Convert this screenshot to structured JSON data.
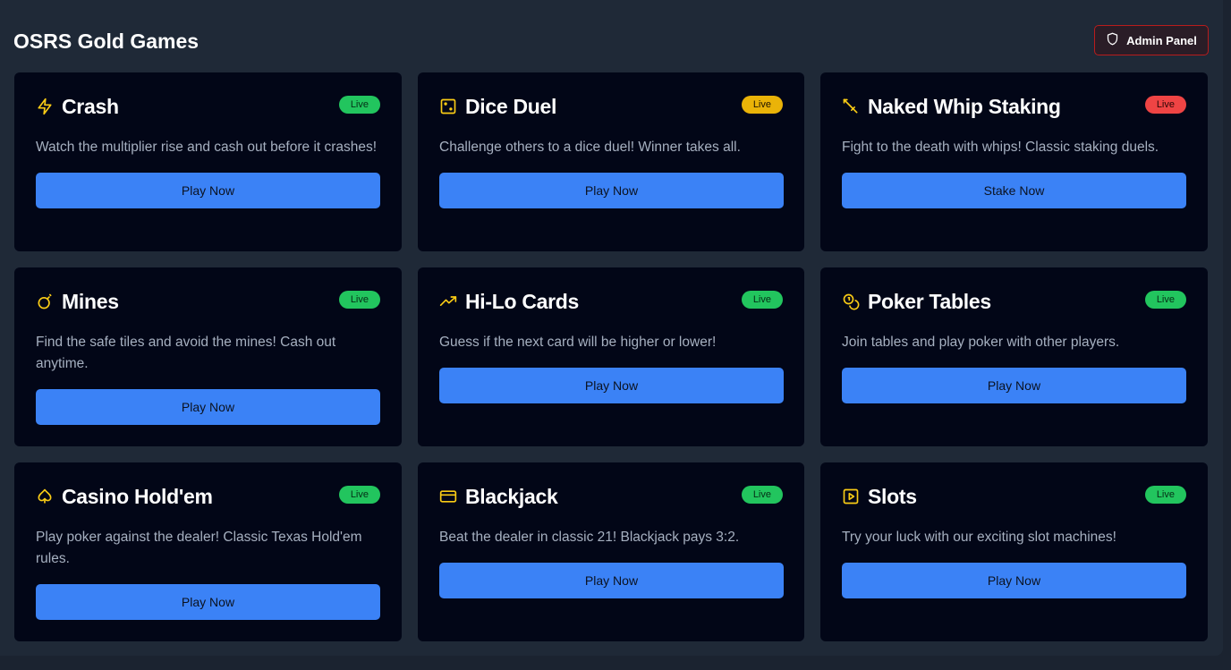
{
  "page": {
    "title": "OSRS Gold Games",
    "admin_label": "Admin Panel"
  },
  "colors": {
    "background": "#1f2937",
    "card": "#020617",
    "accent": "#3b82f6",
    "icon": "#facc15",
    "live_green": "#22c55e",
    "live_yellow": "#eab308",
    "live_red": "#ef4444",
    "admin_border": "#b91c1c"
  },
  "games": [
    {
      "title": "Crash",
      "icon": "lightning-icon",
      "badge": "Live",
      "badge_color": "green",
      "description": "Watch the multiplier rise and cash out before it crashes!",
      "button": "Play Now"
    },
    {
      "title": "Dice Duel",
      "icon": "dice-icon",
      "badge": "Live",
      "badge_color": "yellow",
      "description": "Challenge others to a dice duel! Winner takes all.",
      "button": "Play Now"
    },
    {
      "title": "Naked Whip Staking",
      "icon": "sword-icon",
      "badge": "Live",
      "badge_color": "red",
      "description": "Fight to the death with whips! Classic staking duels.",
      "button": "Stake Now"
    },
    {
      "title": "Mines",
      "icon": "bomb-icon",
      "badge": "Live",
      "badge_color": "green",
      "description": "Find the safe tiles and avoid the mines! Cash out anytime.",
      "button": "Play Now"
    },
    {
      "title": "Hi-Lo Cards",
      "icon": "trending-up-icon",
      "badge": "Live",
      "badge_color": "green",
      "description": "Guess if the next card will be higher or lower!",
      "button": "Play Now"
    },
    {
      "title": "Poker Tables",
      "icon": "coins-icon",
      "badge": "Live",
      "badge_color": "green",
      "description": "Join tables and play poker with other players.",
      "button": "Play Now"
    },
    {
      "title": "Casino Hold'em",
      "icon": "spade-icon",
      "badge": "Live",
      "badge_color": "green",
      "description": "Play poker against the dealer! Classic Texas Hold'em rules.",
      "button": "Play Now"
    },
    {
      "title": "Blackjack",
      "icon": "card-icon",
      "badge": "Live",
      "badge_color": "green",
      "description": "Beat the dealer in classic 21! Blackjack pays 3:2.",
      "button": "Play Now"
    },
    {
      "title": "Slots",
      "icon": "play-square-icon",
      "badge": "Live",
      "badge_color": "green",
      "description": "Try your luck with our exciting slot machines!",
      "button": "Play Now"
    }
  ]
}
